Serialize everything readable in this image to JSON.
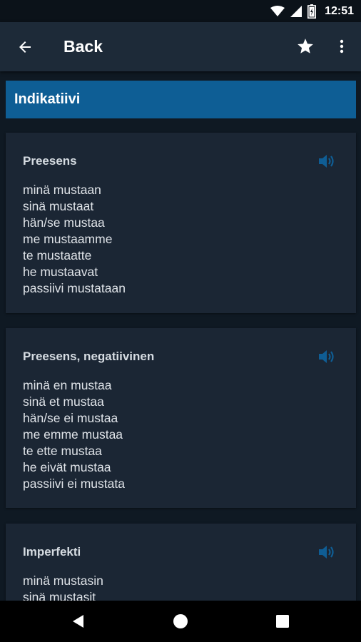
{
  "status_bar": {
    "time": "12:51"
  },
  "app_bar": {
    "title": "Back"
  },
  "section": {
    "title": "Indikatiivi"
  },
  "cards": [
    {
      "title": "Preesens",
      "forms": [
        "minä mustaan",
        "sinä mustaat",
        "hän/se mustaa",
        "me mustaamme",
        "te mustaatte",
        "he mustaavat",
        "passiivi mustataan"
      ]
    },
    {
      "title": "Preesens, negatiivinen",
      "forms": [
        "minä en mustaa",
        "sinä et mustaa",
        "hän/se ei mustaa",
        "me emme mustaa",
        "te ette mustaa",
        "he eivät mustaa",
        "passiivi ei mustata"
      ]
    },
    {
      "title": "Imperfekti",
      "forms": [
        "minä mustasin",
        "sinä mustasit"
      ]
    }
  ],
  "colors": {
    "background": "#0f1923",
    "app_bar": "#1d2a38",
    "section_header": "#0e5e95",
    "card": "#1b2634",
    "speaker_icon": "#0f5d94"
  },
  "icons": {
    "status": [
      "wifi-icon",
      "signal-icon",
      "battery-icon"
    ],
    "app_bar": [
      "arrow-back-icon",
      "star-icon",
      "more-vert-icon"
    ],
    "card": "speaker-icon",
    "nav": [
      "nav-back-icon",
      "nav-home-icon",
      "nav-recents-icon"
    ]
  }
}
